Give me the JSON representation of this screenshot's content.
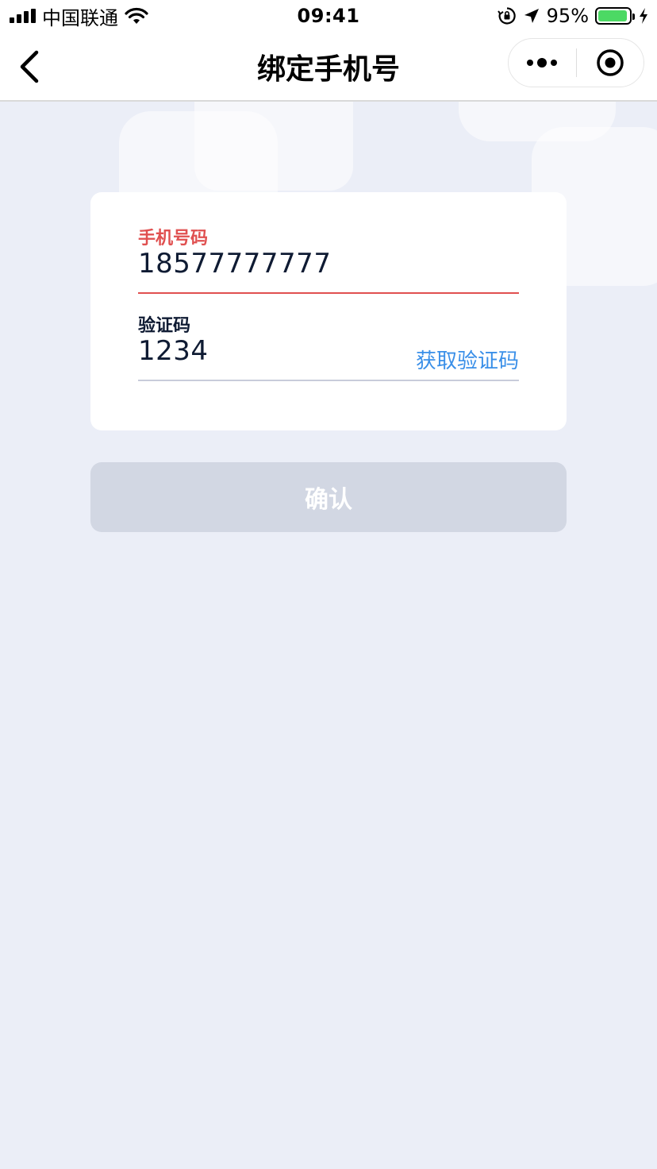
{
  "status_bar": {
    "carrier": "中国联通",
    "time": "09:41",
    "battery_percent": "95%",
    "battery_level": 0.95,
    "icons": [
      "signal-icon",
      "wifi-icon",
      "rotation-lock-icon",
      "location-arrow-icon",
      "battery-icon",
      "charging-bolt-icon"
    ]
  },
  "nav_bar": {
    "title": "绑定手机号",
    "back_icon": "chevron-left-icon",
    "more_icon": "more-dots-icon",
    "close_icon": "target-circle-icon"
  },
  "form": {
    "phone": {
      "label": "手机号码",
      "value": "18577777777"
    },
    "code": {
      "label": "验证码",
      "value": "1234",
      "action_label": "获取验证码"
    }
  },
  "confirm_label": "确认",
  "colors": {
    "background": "#EBEEF7",
    "card": "#FFFFFF",
    "active_label": "#E05050",
    "active_underline": "#E05050",
    "inactive_underline": "#C8CCDA",
    "link": "#3A8FE8",
    "disabled_button": "#D2D7E3",
    "battery_fill": "#4CD964",
    "value_text": "#0F1B33"
  }
}
